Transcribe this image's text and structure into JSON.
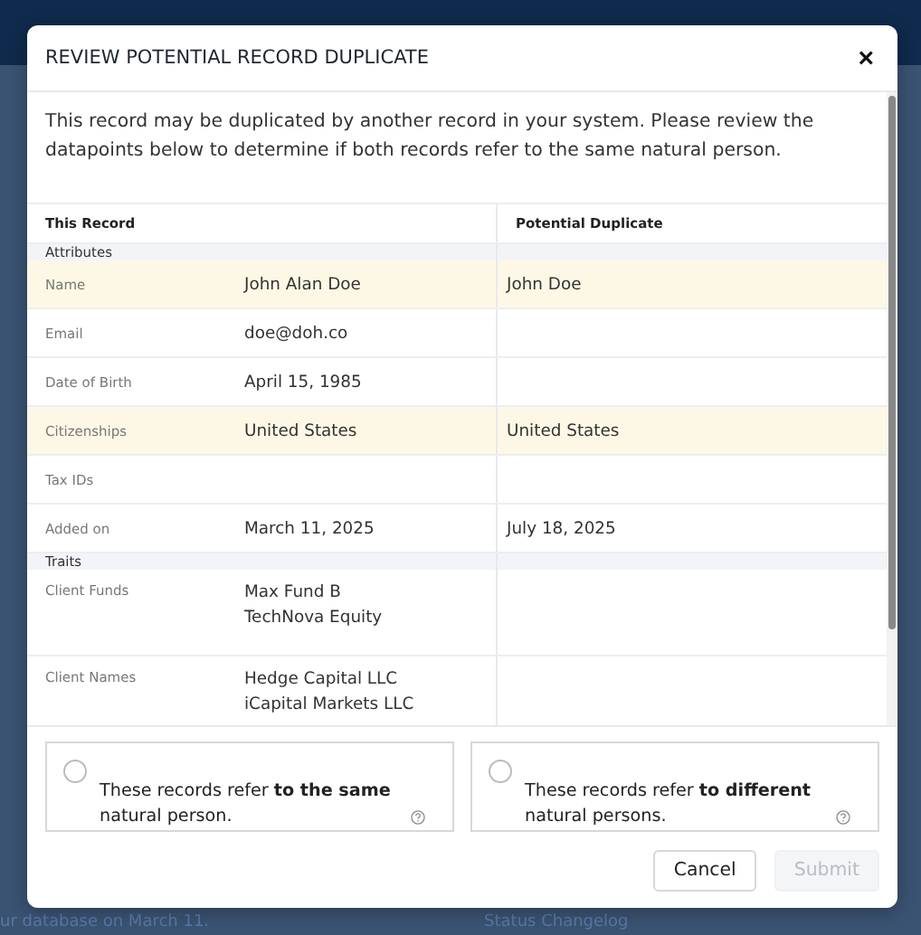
{
  "background": {
    "footer_texts": [
      "ur database on March 11.",
      "Status Changelog"
    ]
  },
  "dialog": {
    "title": "REVIEW POTENTIAL RECORD DUPLICATE",
    "close": "×",
    "description": "This record may be duplicated by another record in your system. Please review the datapoints below to determine if both records refer to the same natural person.",
    "table": {
      "columns": [
        "This Record",
        "Potential Duplicate"
      ],
      "sections": [
        {
          "title": "Attributes",
          "rows": [
            {
              "label": "Name",
              "this": [
                "John Alan Doe"
              ],
              "duplicate": [
                "John Doe"
              ],
              "match": true
            },
            {
              "label": "Email",
              "this": [
                "doe@doh.co"
              ],
              "duplicate": [],
              "match": false
            },
            {
              "label": "Date of Birth",
              "this": [
                "April 15, 1985"
              ],
              "duplicate": [],
              "match": false
            },
            {
              "label": "Citizenships",
              "this": [
                "United States"
              ],
              "duplicate": [
                "United States"
              ],
              "match": true
            },
            {
              "label": "Tax IDs",
              "this": [],
              "duplicate": [],
              "match": false
            },
            {
              "label": "Added on",
              "this": [
                "March 11, 2025"
              ],
              "duplicate": [
                "July 18, 2025"
              ],
              "match": false
            }
          ]
        },
        {
          "title": "Traits",
          "rows": [
            {
              "label": "Client Funds",
              "this": [
                "Max Fund B",
                "TechNova Equity"
              ],
              "duplicate": [],
              "match": false
            },
            {
              "label": "Client Names",
              "this": [
                "Hedge Capital LLC",
                "iCapital Markets LLC"
              ],
              "duplicate": [],
              "match": false
            }
          ]
        }
      ]
    },
    "options": [
      {
        "text": "These records refer **to the same** natural person.",
        "selected": false
      },
      {
        "text": "These records refer **to different** natural persons.",
        "selected": false
      }
    ],
    "buttons": [
      {
        "label": "Cancel",
        "disabled": false
      },
      {
        "label": "Submit",
        "disabled": true
      }
    ]
  }
}
